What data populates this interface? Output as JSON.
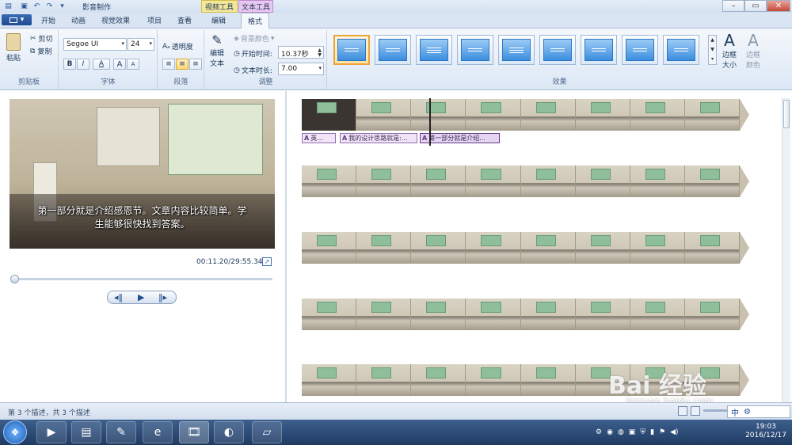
{
  "titlebar": {
    "title": "影音制作",
    "context_tabs": [
      "视频工具",
      "文本工具"
    ]
  },
  "tabs": {
    "app_menu": "▾",
    "items": [
      "开始",
      "动画",
      "视觉效果",
      "项目",
      "查看",
      "编辑",
      "格式"
    ],
    "active": "格式"
  },
  "ribbon": {
    "clipboard": {
      "paste": "粘贴",
      "cut": "剪切",
      "copy": "复制",
      "label": "剪贴板"
    },
    "font": {
      "family": "Segoe UI",
      "size": "24",
      "bold": "B",
      "italic": "I",
      "color": "A",
      "grow": "A",
      "shrink": "A",
      "label": "字体"
    },
    "paragraph": {
      "transparency": "透明度",
      "label": "段落"
    },
    "adjust": {
      "edit_text_1": "编辑",
      "edit_text_2": "文本",
      "bg_color": "背景颜色",
      "start_time_label": "开始时间:",
      "start_time": "10.37秒",
      "duration_label": "文本时长:",
      "duration": "7.00",
      "label": "调整"
    },
    "effects": {
      "label": "效果",
      "outline_size_1": "边框",
      "outline_size_2": "大小",
      "outline_color_1": "边框",
      "outline_color_2": "颜色"
    }
  },
  "preview": {
    "caption_line1": "第一部分就是介绍感恩节。文章内容比较简单。学",
    "caption_line2": "生能够很快找到答案。",
    "timecode": "00:11.20/29:55.34"
  },
  "timeline": {
    "captions": [
      "英...",
      "我的设计思路就是:...",
      "第一部分就是介绍..."
    ]
  },
  "status": {
    "text": "第 3 个描述，共 3 个描述"
  },
  "taskbar": {
    "time": "19:03",
    "date": "2016/12/17",
    "ime": "中"
  },
  "watermark": {
    "brand": "Bai 经验",
    "url": "jingyan.baidu.com"
  }
}
